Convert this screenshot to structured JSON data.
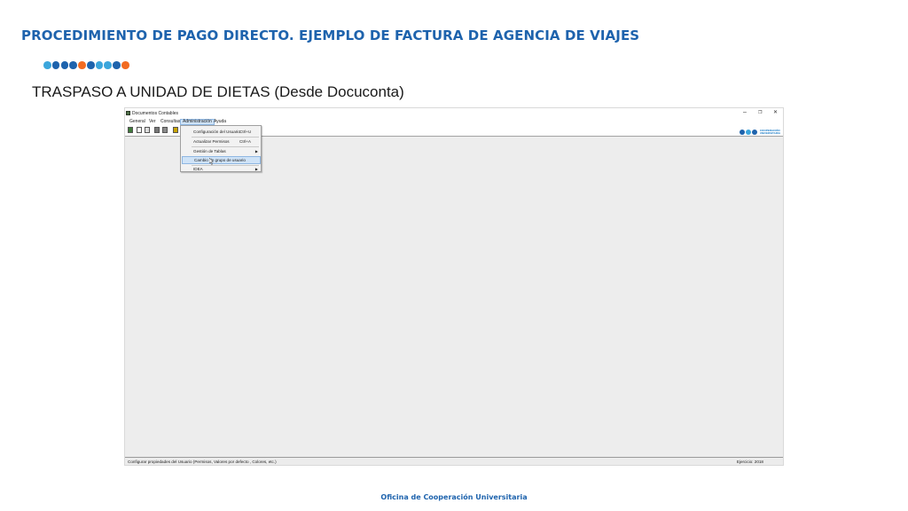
{
  "slide": {
    "title": "PROCEDIMIENTO DE PAGO DIRECTO. EJEMPLO DE FACTURA DE AGENCIA DE VIAJES",
    "subtitle": "TRASPASO A UNIDAD DE DIETAS (Desde Docuconta)",
    "footer": "Oficina de Cooperación Universitaria",
    "dot_colors": [
      "#3ba6dc",
      "#1e63ad",
      "#1e63ad",
      "#1e63ad",
      "#f26b21",
      "#1e63ad",
      "#3ba6dc",
      "#3ba6dc",
      "#1e63ad",
      "#f26b21"
    ]
  },
  "window": {
    "title": "Documentos Contables",
    "controls": {
      "minimize": "–",
      "restore": "❐",
      "close": "✕"
    },
    "menu": [
      "General",
      "Ver",
      "Consultas",
      "Administración",
      "Ayuda"
    ],
    "logo_text": [
      "COOPERACIÓN",
      "UNIVERSITARIA"
    ],
    "dropdown": {
      "items": [
        {
          "label": "Configuración del Usuario",
          "shortcut": "Ctrl+U"
        },
        {
          "label": "Actualizar Permisos",
          "shortcut": "Ctrl+A"
        },
        {
          "label": "Gestión de Tablas",
          "shortcut": ""
        },
        {
          "label": "Cambio de grupo de usuario",
          "shortcut": ""
        },
        {
          "label": "IDEA",
          "shortcut": ""
        }
      ]
    },
    "status": {
      "left": "Configurar propiedades del Usuario (Permisos, Valores por defecto , Colores, etc.)",
      "right": "Ejercicio: 2018"
    }
  }
}
